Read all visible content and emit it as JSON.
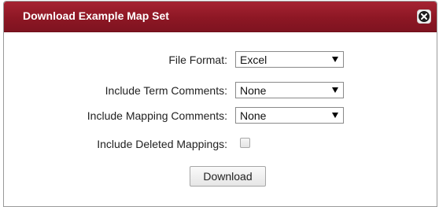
{
  "dialog": {
    "title": "Download Example Map Set",
    "close_icon": "close-icon",
    "accent_color": "#8d1724"
  },
  "form": {
    "file_format": {
      "label": "File Format:",
      "value": "Excel"
    },
    "term_comments": {
      "label": "Include Term Comments:",
      "value": "None"
    },
    "mapping_comments": {
      "label": "Include Mapping Comments:",
      "value": "None"
    },
    "deleted_mappings": {
      "label": "Include Deleted Mappings:",
      "checked": false
    }
  },
  "actions": {
    "download_label": "Download"
  }
}
